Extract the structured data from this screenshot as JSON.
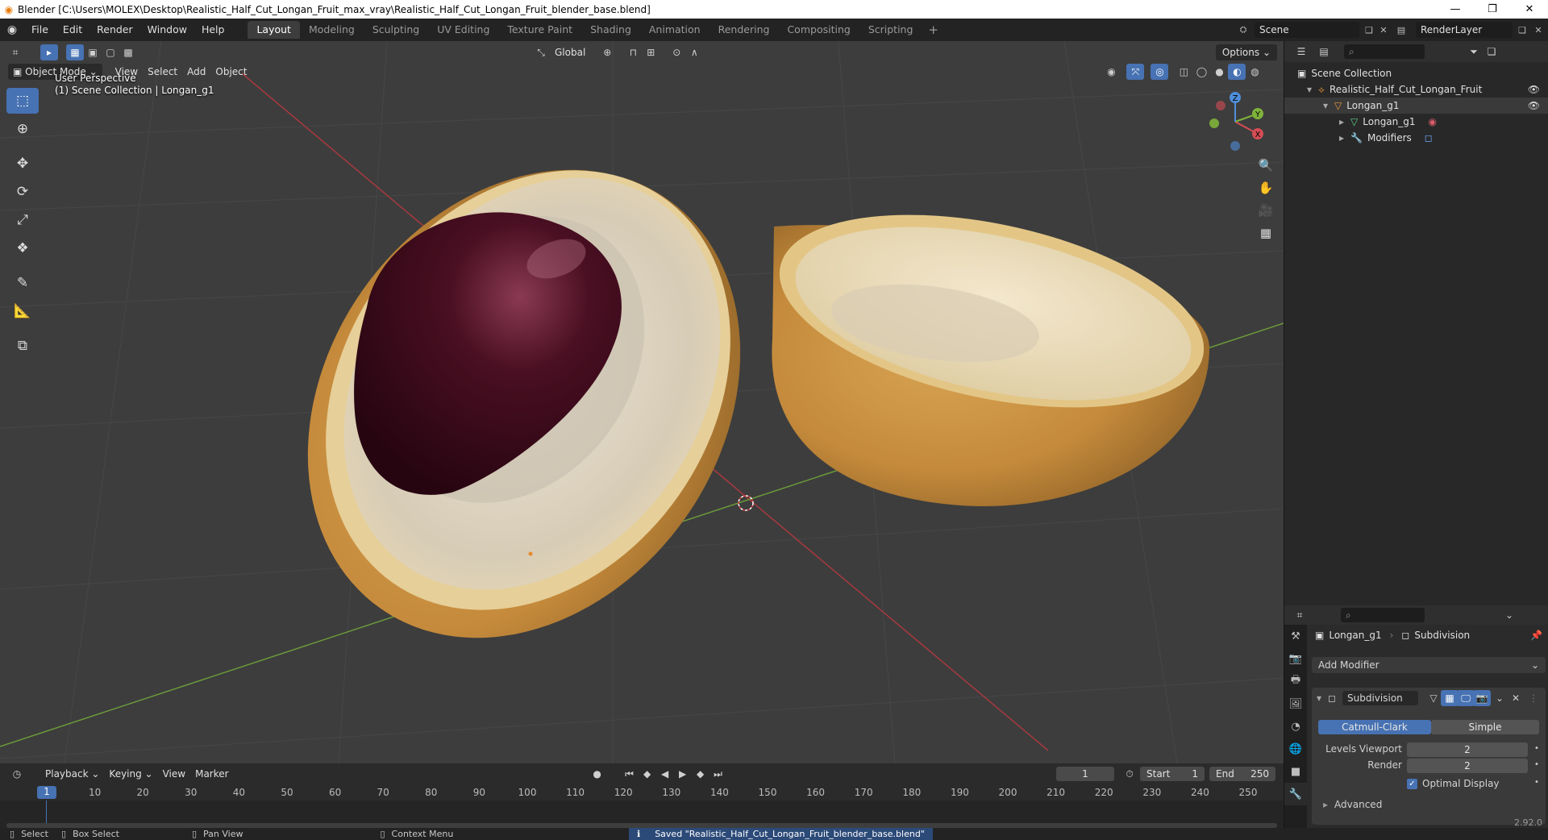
{
  "window": {
    "title": "Blender [C:\\Users\\MOLEX\\Desktop\\Realistic_Half_Cut_Longan_Fruit_max_vray\\Realistic_Half_Cut_Longan_Fruit_blender_base.blend]",
    "minimize": "—",
    "restore": "❐",
    "close": "✕"
  },
  "menu": [
    "File",
    "Edit",
    "Render",
    "Window",
    "Help"
  ],
  "workspaces": [
    {
      "label": "Layout",
      "active": true
    },
    {
      "label": "Modeling"
    },
    {
      "label": "Sculpting"
    },
    {
      "label": "UV Editing"
    },
    {
      "label": "Texture Paint"
    },
    {
      "label": "Shading"
    },
    {
      "label": "Animation"
    },
    {
      "label": "Rendering"
    },
    {
      "label": "Compositing"
    },
    {
      "label": "Scripting"
    }
  ],
  "workspace_add": "+",
  "scene": {
    "name": "Scene",
    "render_layer": "RenderLayer"
  },
  "viewport": {
    "mode": "Object Mode",
    "menus": [
      "View",
      "Select",
      "Add",
      "Object"
    ],
    "orientation": "Global",
    "options": "Options",
    "perspective": "User Perspective",
    "collection_info": "(1) Scene Collection | Longan_g1",
    "gizmo_axes": {
      "x": "X",
      "y": "Y",
      "z": "Z"
    }
  },
  "outliner": {
    "root": "Scene Collection",
    "collection": "Realistic_Half_Cut_Longan_Fruit",
    "object": "Longan_g1",
    "mesh": "Longan_g1",
    "modifiers": "Modifiers"
  },
  "properties": {
    "object_name": "Longan_g1",
    "modifier_crumb": "Subdivision",
    "add_modifier": "Add Modifier",
    "modifier_name": "Subdivision",
    "catmull": "Catmull-Clark",
    "simple": "Simple",
    "levels_viewport_label": "Levels Viewport",
    "levels_viewport": "2",
    "render_label": "Render",
    "render": "2",
    "optimal_display": "Optimal Display",
    "advanced": "Advanced"
  },
  "timeline": {
    "menus": [
      "Playback",
      "Keying",
      "View",
      "Marker"
    ],
    "current_frame": "1",
    "start_label": "Start",
    "start": "1",
    "end_label": "End",
    "end": "250",
    "ticks": [
      "10",
      "20",
      "30",
      "40",
      "50",
      "60",
      "70",
      "80",
      "90",
      "100",
      "110",
      "120",
      "130",
      "140",
      "150",
      "160",
      "170",
      "180",
      "190",
      "200",
      "210",
      "220",
      "230",
      "240",
      "250"
    ],
    "cursor": "1"
  },
  "status": {
    "select": "Select",
    "box_select": "Box Select",
    "pan_view": "Pan View",
    "context_menu": "Context Menu",
    "saved": "Saved \"Realistic_Half_Cut_Longan_Fruit_blender_base.blend\"",
    "version": "2.92.0"
  }
}
